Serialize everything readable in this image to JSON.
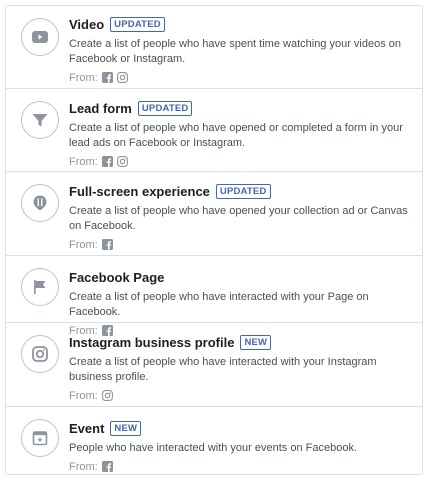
{
  "from_label": "From:",
  "colors": {
    "badge": "#4267b2",
    "icon_gray": "#8d949e",
    "border": "#dddfe2"
  },
  "items": [
    {
      "title": "Video",
      "badge": "UPDATED",
      "icon": "play-video-icon",
      "description": "Create a list of people who have spent time watching your videos on Facebook or Instagram.",
      "sources": [
        "facebook-icon",
        "instagram-icon"
      ]
    },
    {
      "title": "Lead form",
      "badge": "UPDATED",
      "icon": "funnel-icon",
      "description": "Create a list of people who have opened or completed a form in your lead ads on Facebook or Instagram.",
      "sources": [
        "facebook-icon",
        "instagram-icon"
      ]
    },
    {
      "title": "Full-screen experience",
      "badge": "UPDATED",
      "icon": "full-screen-experience-icon",
      "description": "Create a list of people who have opened your collection ad or Canvas on Facebook.",
      "sources": [
        "facebook-icon"
      ]
    },
    {
      "title": "Facebook Page",
      "badge": "",
      "icon": "flag-icon",
      "description": "Create a list of people who have interacted with your Page on Facebook.",
      "sources": [
        "facebook-icon"
      ]
    },
    {
      "title": "Instagram business profile",
      "badge": "NEW",
      "icon": "instagram-profile-icon",
      "description": "Create a list of people who have interacted with your Instagram business profile.",
      "sources": [
        "instagram-icon"
      ]
    },
    {
      "title": "Event",
      "badge": "NEW",
      "icon": "calendar-event-icon",
      "description": "People who have interacted with your events on Facebook.",
      "sources": [
        "facebook-icon"
      ]
    }
  ]
}
